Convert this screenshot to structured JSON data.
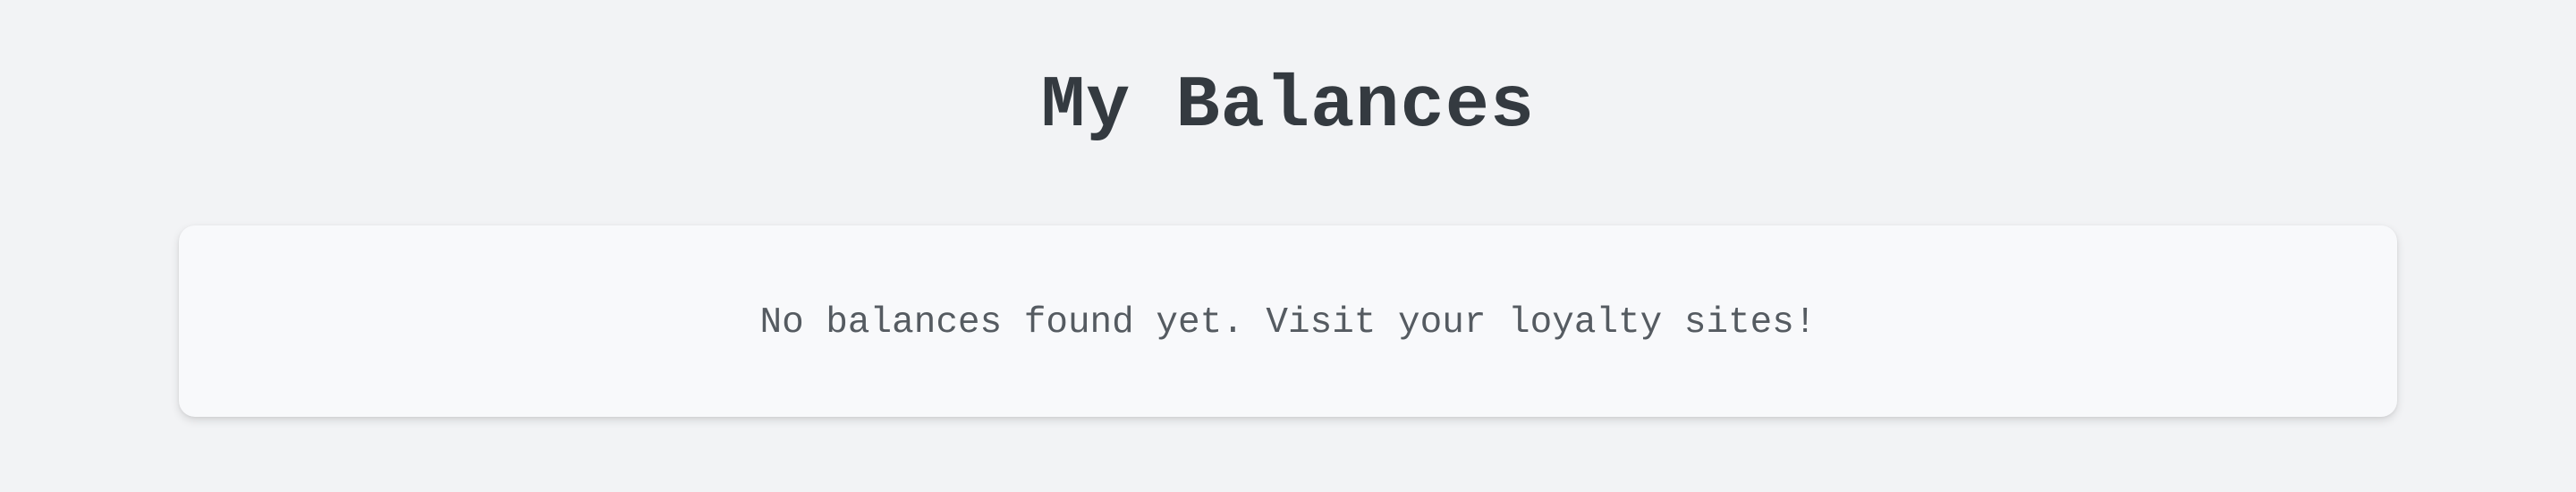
{
  "header": {
    "title": "My Balances"
  },
  "balances": {
    "items": [],
    "empty_message": "No balances found yet. Visit your loyalty sites!"
  },
  "colors": {
    "background": "#f2f3f5",
    "card": "#f8f9fb",
    "title_text": "#343a40",
    "body_text": "#555b61"
  }
}
